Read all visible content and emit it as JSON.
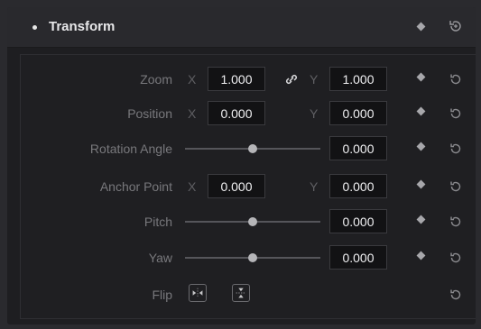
{
  "header": {
    "title": "Transform"
  },
  "rows": {
    "zoom": {
      "label": "Zoom",
      "x_axis": "X",
      "y_axis": "Y",
      "x_value": "1.000",
      "y_value": "1.000"
    },
    "position": {
      "label": "Position",
      "x_axis": "X",
      "y_axis": "Y",
      "x_value": "0.000",
      "y_value": "0.000"
    },
    "rotation": {
      "label": "Rotation Angle",
      "value": "0.000",
      "slider_level": 0.5
    },
    "anchor": {
      "label": "Anchor Point",
      "x_axis": "X",
      "y_axis": "Y",
      "x_value": "0.000",
      "y_value": "0.000"
    },
    "pitch": {
      "label": "Pitch",
      "value": "0.000",
      "slider_level": 0.5
    },
    "yaw": {
      "label": "Yaw",
      "value": "0.000",
      "slider_level": 0.5
    },
    "flip": {
      "label": "Flip"
    }
  },
  "icons": {
    "keyframe": "diamond-icon",
    "reset": "reset-icon",
    "link": "link-icon",
    "flip_horizontal": "flip-horizontal-icon",
    "flip_vertical": "flip-vertical-icon"
  },
  "colors": {
    "background": "#2a2a2e",
    "field": "#121214",
    "text": "#f0f0f2"
  }
}
